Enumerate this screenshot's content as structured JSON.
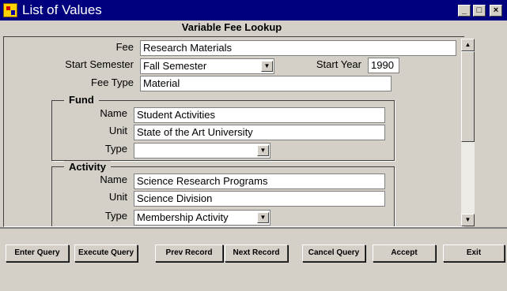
{
  "window": {
    "title": "List of Values",
    "minimize": "_",
    "maximize": "□",
    "close": "×"
  },
  "heading": "Variable Fee Lookup",
  "form": {
    "fee": {
      "label": "Fee",
      "value": "Research Materials"
    },
    "start_semester": {
      "label": "Start Semester",
      "value": "Fall Semester"
    },
    "start_year": {
      "label": "Start Year",
      "value": "1990"
    },
    "fee_type": {
      "label": "Fee Type",
      "value": "Material"
    }
  },
  "fund": {
    "title": "Fund",
    "name": {
      "label": "Name",
      "value": "Student Activities"
    },
    "unit": {
      "label": "Unit",
      "value": "State of the Art University"
    },
    "type": {
      "label": "Type",
      "value": ""
    }
  },
  "activity": {
    "title": "Activity",
    "name": {
      "label": "Name",
      "value": "Science Research Programs"
    },
    "unit": {
      "label": "Unit",
      "value": "Science Division"
    },
    "type": {
      "label": "Type",
      "value": "Membership Activity"
    }
  },
  "buttons": {
    "enter_query": "Enter Query",
    "execute_query": "Execute Query",
    "prev_record": "Prev Record",
    "next_record": "Next Record",
    "cancel_query": "Cancel Query",
    "accept": "Accept",
    "exit": "Exit"
  },
  "icons": {
    "dropdown": "▼",
    "scroll_up": "▲",
    "scroll_down": "▼"
  }
}
